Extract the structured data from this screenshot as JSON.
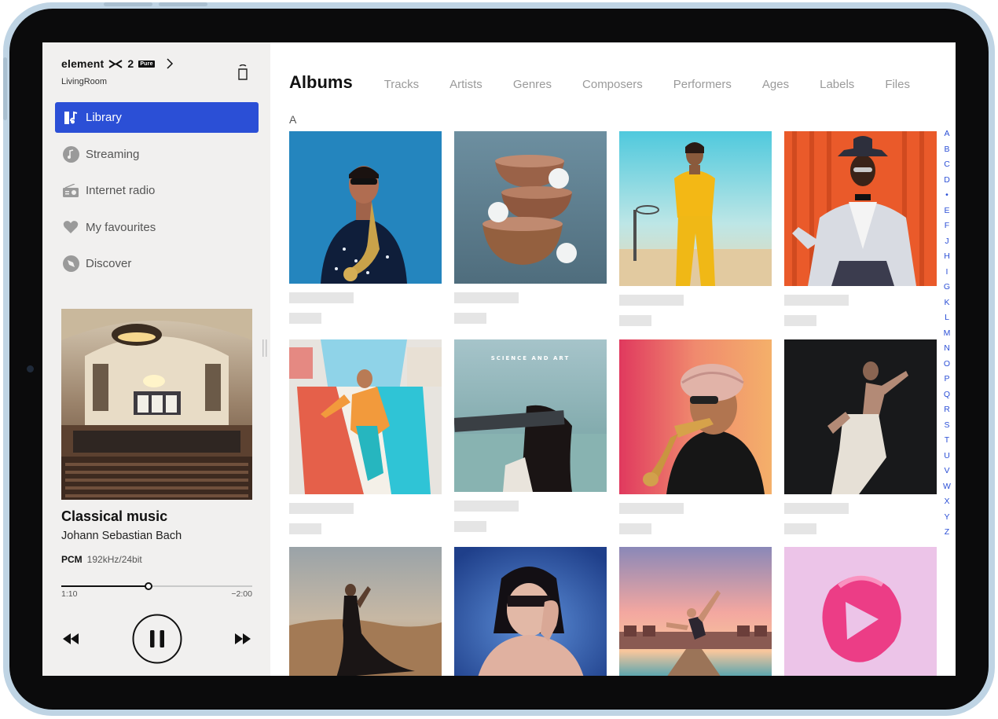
{
  "device": {
    "frame_color": "#bfd4e4"
  },
  "player": {
    "brand": "element",
    "brand_model": "2",
    "brand_badge": "Pure",
    "room": "LivingRoom"
  },
  "nav": {
    "items": [
      {
        "label": "Library",
        "icon": "library-icon",
        "active": true
      },
      {
        "label": "Streaming",
        "icon": "music-note-icon"
      },
      {
        "label": "Internet radio",
        "icon": "radio-icon"
      },
      {
        "label": "My favourites",
        "icon": "heart-icon"
      },
      {
        "label": "Discover",
        "icon": "compass-icon"
      }
    ],
    "accent": "#2b4fd6"
  },
  "now_playing": {
    "title": "Classical music",
    "artist": "Johann Sebastian Bach",
    "format": "PCM",
    "quality": "192kHz/24bit",
    "elapsed": "1:10",
    "remaining": "−2:00",
    "progress_fraction": 0.455
  },
  "tabs": [
    "Albums",
    "Tracks",
    "Artists",
    "Genres",
    "Composers",
    "Performers",
    "Ages",
    "Labels",
    "Files"
  ],
  "active_tab": "Albums",
  "section_letter": "A",
  "album_art_caption": "SCIENCE AND ART",
  "alphabet": [
    "A",
    "B",
    "C",
    "D",
    "•",
    "E",
    "F",
    "J",
    "H",
    "I",
    "G",
    "K",
    "L",
    "M",
    "N",
    "O",
    "P",
    "Q",
    "R",
    "S",
    "T",
    "U",
    "V",
    "W",
    "X",
    "Y",
    "Z"
  ]
}
